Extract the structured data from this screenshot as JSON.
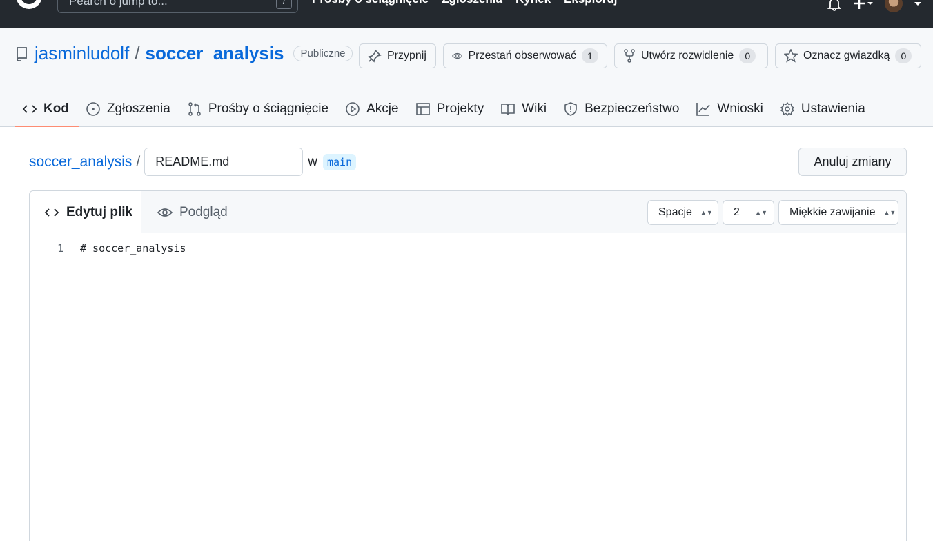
{
  "header": {
    "search_placeholder": "Pearch o jump to...",
    "search_shortcut": "/",
    "nav": [
      "Prosby o ściągnięcie",
      "Zgłoszenia",
      "Rynek",
      "Eksploruj"
    ]
  },
  "repo": {
    "owner": "jasminludolf",
    "separator": "/",
    "name": "soccer_analysis",
    "visibility": "Publiczne",
    "actions": {
      "pin": "Przypnij",
      "watch": "Przestań obserwować",
      "watch_count": "1",
      "fork": "Utwórz rozwidlenie",
      "fork_count": "0",
      "star": "Oznacz gwiazdką",
      "star_count": "0"
    },
    "tabs": {
      "code": "Kod",
      "issues": "Zgłoszenia",
      "pulls": "Prośby o ściągnięcie",
      "actions": "Akcje",
      "projects": "Projekty",
      "wiki": "Wiki",
      "security": "Bezpieczeństwo",
      "insights": "Wnioski",
      "settings": "Ustawienia"
    }
  },
  "file": {
    "repo_link": "soccer_analysis",
    "separator": "/",
    "filename": "README.md",
    "in_label": "w",
    "branch": "main",
    "cancel": "Anuluj zmiany"
  },
  "editor": {
    "edit_tab": "Edytuj plik",
    "preview_tab": "Podgląd",
    "indent_mode": "Spacje",
    "indent_size": "2",
    "wrap_mode": "Miękkie zawijanie",
    "lines": [
      {
        "num": "1",
        "text": "# soccer_analysis"
      }
    ]
  },
  "colors": {
    "header_bg": "#24292f",
    "link": "#0969da",
    "active_tab_underline": "#fd8c73",
    "branch_bg": "#ddf4ff"
  }
}
